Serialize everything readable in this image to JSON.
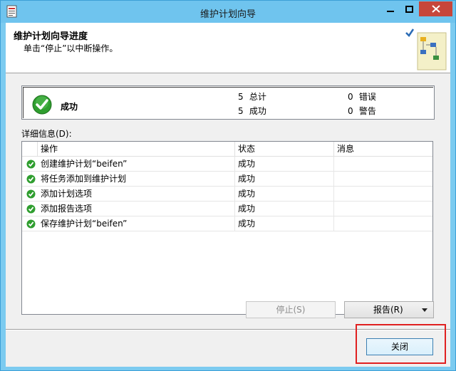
{
  "window": {
    "title": "维护计划向导"
  },
  "header": {
    "title": "维护计划向导进度",
    "subtitle": "单击“停止”以中断操作。"
  },
  "summary": {
    "status": "成功",
    "total_count": "5",
    "total_label": "总计",
    "success_count": "5",
    "success_label": "成功",
    "error_count": "0",
    "error_label": "错误",
    "warning_count": "0",
    "warning_label": "警告"
  },
  "details": {
    "label": "详细信息(D):",
    "columns": [
      "操作",
      "状态",
      "消息"
    ],
    "rows": [
      {
        "action": "创建维护计划“beifen”",
        "status": "成功",
        "message": ""
      },
      {
        "action": "将任务添加到维护计划",
        "status": "成功",
        "message": ""
      },
      {
        "action": "添加计划选项",
        "status": "成功",
        "message": ""
      },
      {
        "action": "添加报告选项",
        "status": "成功",
        "message": ""
      },
      {
        "action": "保存维护计划“beifen”",
        "status": "成功",
        "message": ""
      }
    ]
  },
  "buttons": {
    "stop": "停止(S)",
    "report": "报告(R)",
    "close": "关闭"
  },
  "colors": {
    "titlebar": "#6fc4ee",
    "close_button": "#c7463b",
    "success_green": "#2f9e2f",
    "highlight_box": "#e02020"
  }
}
